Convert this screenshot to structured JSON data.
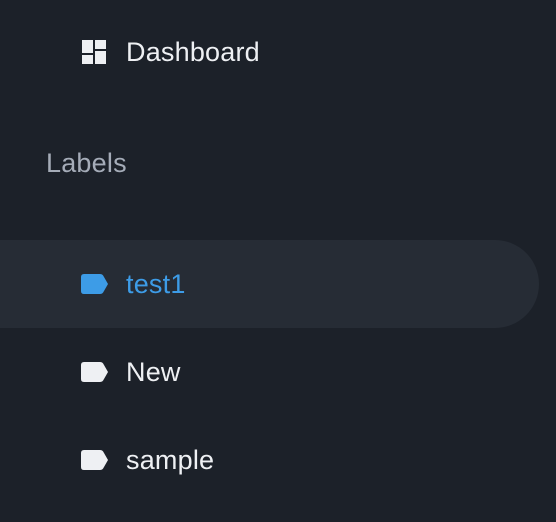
{
  "sidebar": {
    "dashboard": {
      "label": "Dashboard",
      "icon": "dashboard-icon"
    },
    "labels_section": {
      "title": "Labels",
      "items": [
        {
          "label": "test1",
          "icon": "label-tag-icon",
          "active": true,
          "color": "#3d9ce7"
        },
        {
          "label": "New",
          "icon": "label-tag-icon",
          "active": false,
          "color": "#eef0f3"
        },
        {
          "label": "sample",
          "icon": "label-tag-icon",
          "active": false,
          "color": "#eef0f3"
        }
      ]
    }
  },
  "colors": {
    "background": "#1c2129",
    "active_background": "#262c35",
    "accent": "#3d9ce7",
    "text": "#eef0f3",
    "section_title": "#a5acb8"
  }
}
